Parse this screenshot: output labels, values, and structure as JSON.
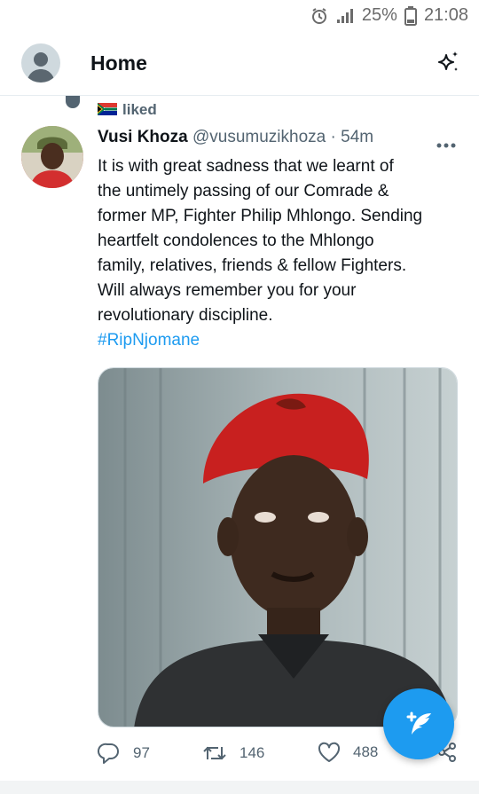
{
  "status_bar": {
    "battery_percent": "25%",
    "time": "21:08",
    "icons": [
      "alarm-icon",
      "signal-icon",
      "battery-icon"
    ]
  },
  "header": {
    "title": "Home",
    "icons": [
      "avatar",
      "sparkle-icon"
    ]
  },
  "social_context": {
    "label": "liked"
  },
  "tweet": {
    "author_name": "Vusi Khoza",
    "author_handle": "@vusumuzikhoza",
    "separator": "·",
    "time": "54m",
    "text_lines": [
      "It is with great sadness that we learnt of",
      "the untimely passing of our Comrade &",
      "former MP, Fighter Philip Mhlongo. Sending",
      "heartfelt condolences to the Mhlongo",
      "family, relatives, friends & fellow Fighters.",
      "Will always remember you for your",
      "revolutionary discipline."
    ],
    "hashtag": "#RipNjomane",
    "stats": {
      "replies": "97",
      "retweets": "146",
      "likes": "488"
    }
  },
  "colors": {
    "accent": "#1d9bf0",
    "text_primary": "#0f1419",
    "text_secondary": "#536471"
  }
}
